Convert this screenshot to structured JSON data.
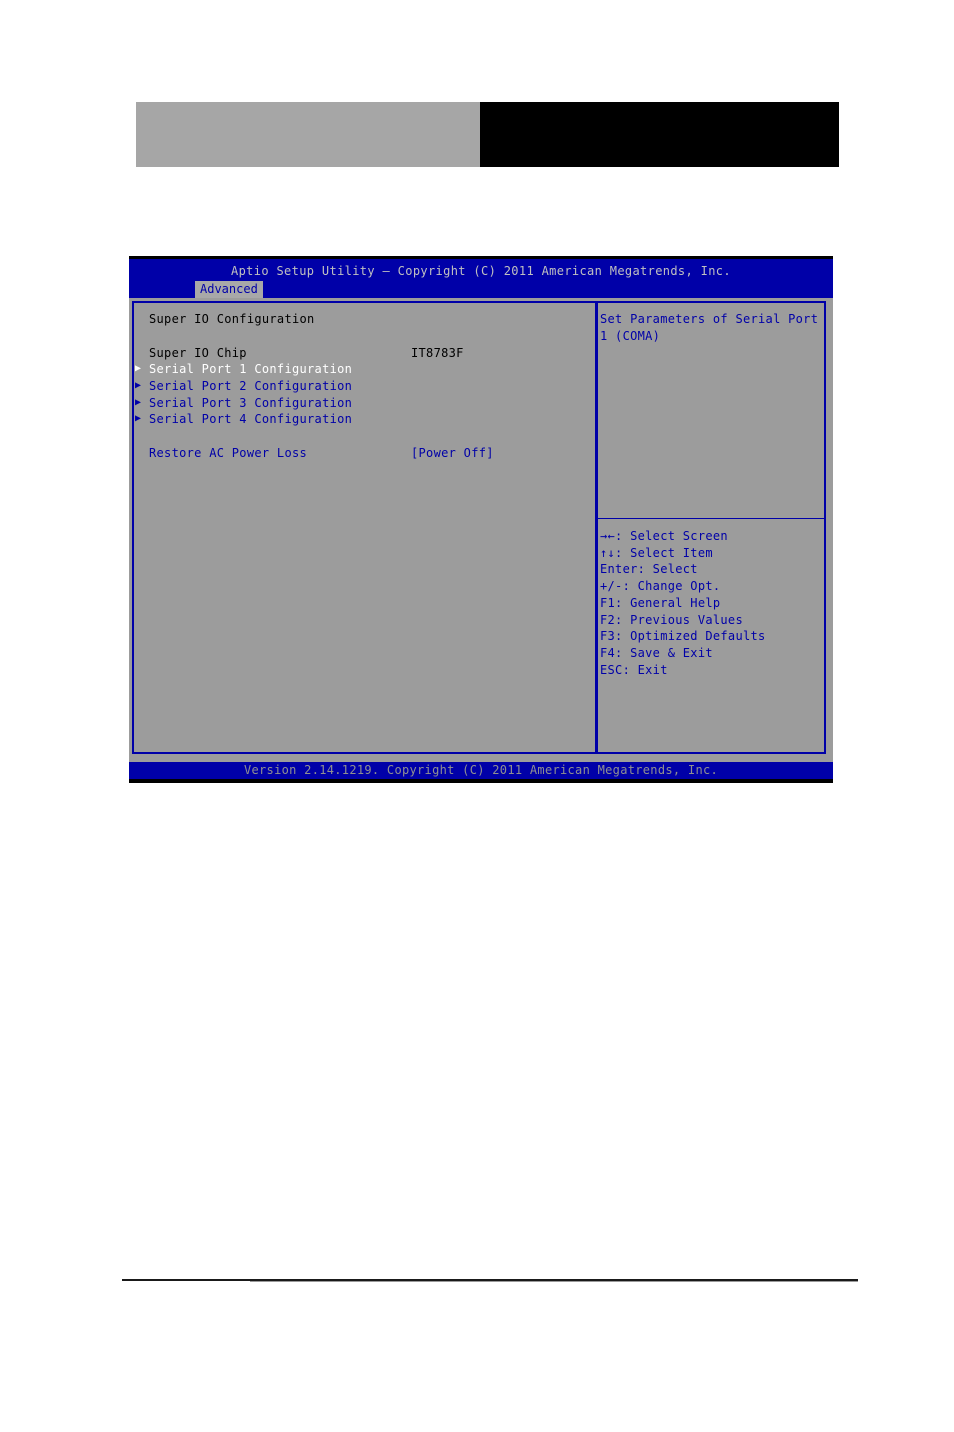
{
  "page_header": {
    "left_block_color": "#a6a6a6",
    "right_block_color": "#000000"
  },
  "bios": {
    "title": "Aptio Setup Utility – Copyright (C) 2011 American Megatrends, Inc.",
    "active_tab": "Advanced",
    "section_title": "Super IO Configuration",
    "chip": {
      "label": "Super IO Chip",
      "value": "IT8783F"
    },
    "submenus": [
      {
        "label": "Serial Port 1 Configuration",
        "selected": true
      },
      {
        "label": "Serial Port 2 Configuration",
        "selected": false
      },
      {
        "label": "Serial Port 3 Configuration",
        "selected": false
      },
      {
        "label": "Serial Port 4 Configuration",
        "selected": false
      }
    ],
    "submenu_arrow": "▶",
    "setting": {
      "label": "Restore AC Power Loss",
      "value": "[Power Off]"
    },
    "help_text": [
      "Set Parameters of Serial Port",
      "1 (COMA)"
    ],
    "keys": [
      "→←: Select Screen",
      "↑↓: Select Item",
      "Enter: Select",
      "+/-: Change Opt.",
      "F1: General Help",
      "F2: Previous Values",
      "F3: Optimized Defaults",
      "F4: Save & Exit",
      "ESC: Exit"
    ],
    "footer": "Version 2.14.1219. Copyright (C) 2011 American Megatrends, Inc.",
    "colors": {
      "frame_blue": "#0000a8",
      "panel_gray": "#9c9c9c",
      "selected_text": "#ffffff"
    }
  }
}
